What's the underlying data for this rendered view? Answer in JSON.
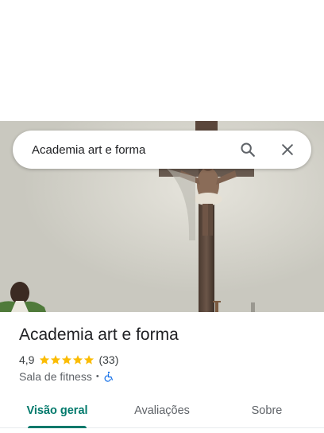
{
  "search": {
    "query": "Academia art e forma"
  },
  "icons": {
    "search": "search-icon",
    "close": "close-icon",
    "star": "star-icon",
    "accessibility": "wheelchair-icon"
  },
  "place": {
    "name": "Academia art e forma",
    "rating": "4,9",
    "stars": 5,
    "review_count": "(33)",
    "category": "Sala de fitness",
    "separator": "•"
  },
  "tabs": [
    {
      "label": "Visão geral",
      "active": true
    },
    {
      "label": "Avaliações",
      "active": false
    },
    {
      "label": "Sobre",
      "active": false
    }
  ],
  "colors": {
    "accent": "#00796b",
    "star": "#fbbc04",
    "accessibility_icon": "#1a73e8"
  }
}
